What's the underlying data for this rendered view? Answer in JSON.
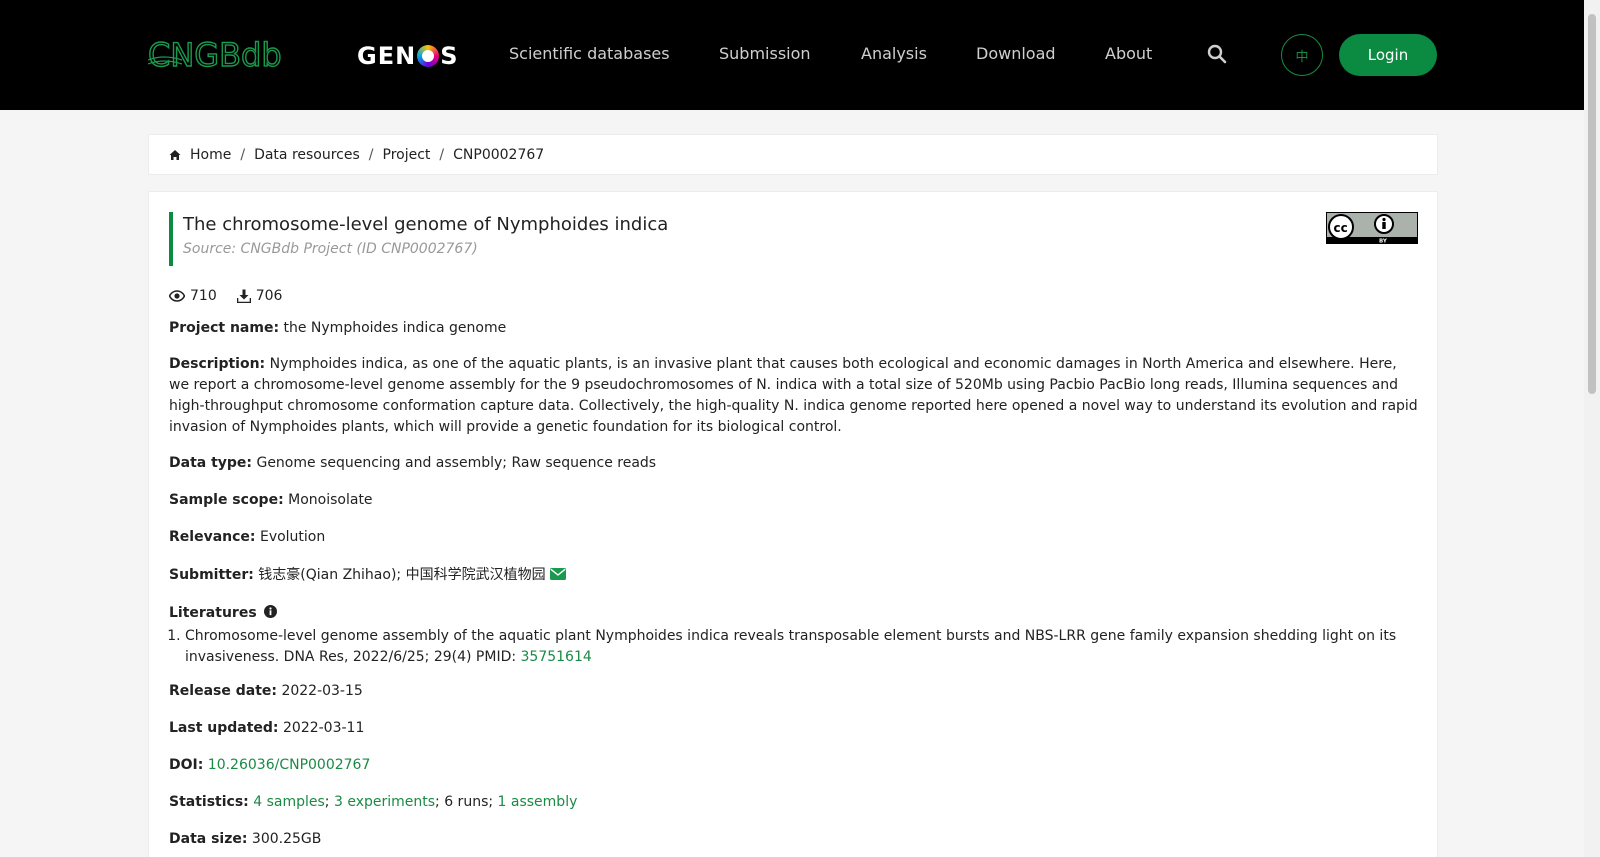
{
  "header": {
    "logo_text": "CNGBdb",
    "genos_pre": "GEN",
    "genos_post": "S",
    "nav": [
      "Scientific databases",
      "Submission",
      "Analysis",
      "Download",
      "About"
    ],
    "lang_label": "中",
    "login_label": "Login"
  },
  "breadcrumb": [
    "Home",
    "Data resources",
    "Project",
    "CNP0002767"
  ],
  "project": {
    "title": "The chromosome-level genome of Nymphoides indica",
    "source": "Source: CNGBdb Project (ID CNP0002767)",
    "views": "710",
    "downloads": "706",
    "name_label": "Project name:",
    "name_value": "the Nymphoides indica genome",
    "desc_label": "Description:",
    "desc_value": "Nymphoides indica, as one of the aquatic plants, is an invasive plant that causes both ecological and economic damages in North America and elsewhere. Here, we report a chromosome-level genome assembly for the 9 pseudochromosomes of N. indica with a total size of 520Mb using Pacbio PacBio long reads, Illumina sequences and high-throughput chromosome conformation capture data. Collectively, the high-quality N. indica genome reported here opened a novel way to understand its evolution and rapid invasion of Nymphoides plants, which will provide a genetic foundation for its biological control.",
    "datatype_label": "Data type:",
    "datatype_value": "Genome sequencing and assembly; Raw sequence reads",
    "scope_label": "Sample scope:",
    "scope_value": "Monoisolate",
    "relevance_label": "Relevance:",
    "relevance_value": "Evolution",
    "submitter_label": "Submitter:",
    "submitter_value": "钱志豪(Qian Zhihao); 中国科学院武汉植物园",
    "literatures_label": "Literatures",
    "literature_text": "Chromosome-level genome assembly of the aquatic plant Nymphoides indica reveals transposable element bursts and NBS-LRR gene family expansion shedding light on its invasiveness. DNA Res, 2022/6/25; 29(4) PMID: ",
    "literature_pmid": "35751614",
    "release_label": "Release date:",
    "release_value": "2022-03-15",
    "updated_label": "Last updated:",
    "updated_value": "2022-03-11",
    "doi_label": "DOI:",
    "doi_value": "10.26036/CNP0002767",
    "stats_label": "Statistics:",
    "stats_samples": "4 samples",
    "stats_experiments": "3 experiments",
    "stats_runs": "6 runs",
    "stats_assembly": "1 assembly",
    "size_label": "Data size:",
    "size_value": "300.25GB"
  },
  "colors": {
    "accent": "#0b8a42",
    "link": "#1a8a45",
    "header_bg": "#000000"
  }
}
